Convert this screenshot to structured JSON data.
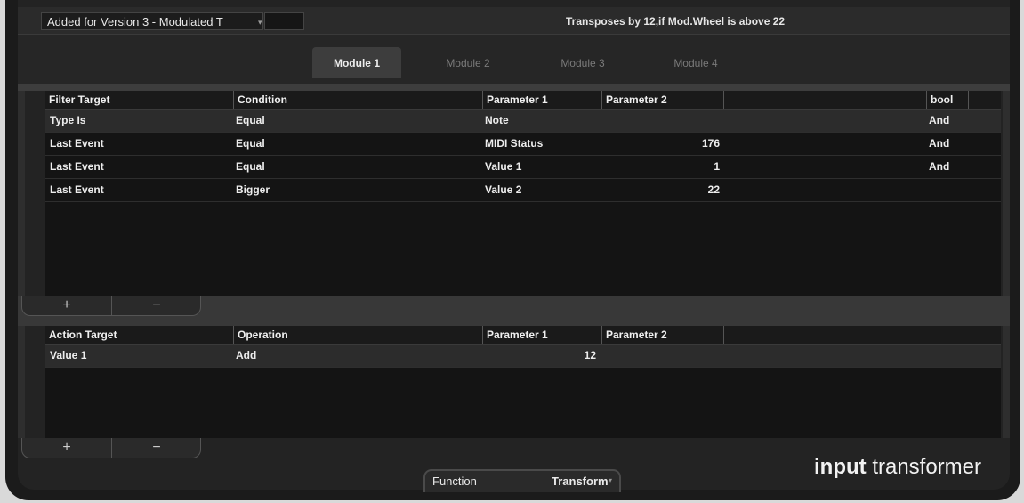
{
  "preset": {
    "name": "Added for Version 3 - Modulated T",
    "arrow": "▾"
  },
  "description": "Transposes by 12,if Mod.Wheel is above 22",
  "tabs": [
    {
      "label": "Module 1",
      "active": true
    },
    {
      "label": "Module 2",
      "active": false
    },
    {
      "label": "Module 3",
      "active": false
    },
    {
      "label": "Module 4",
      "active": false
    }
  ],
  "filter_table": {
    "headers": [
      "Filter Target",
      "Condition",
      "Parameter 1",
      "Parameter 2",
      "bool"
    ],
    "rows": [
      {
        "target": "Type Is",
        "condition": "Equal",
        "param1": "Note",
        "param2": "",
        "bool": "And"
      },
      {
        "target": "Last Event",
        "condition": "Equal",
        "param1": "MIDI Status",
        "param2": "176",
        "bool": "And"
      },
      {
        "target": "Last Event",
        "condition": "Equal",
        "param1": "Value 1",
        "param2": "1",
        "bool": "And"
      },
      {
        "target": "Last Event",
        "condition": "Bigger",
        "param1": "Value 2",
        "param2": "22",
        "bool": ""
      }
    ]
  },
  "action_table": {
    "headers": [
      "Action Target",
      "Operation",
      "Parameter 1",
      "Parameter 2"
    ],
    "rows": [
      {
        "target": "Value 1",
        "operation": "Add",
        "param1": "12",
        "param2": ""
      }
    ]
  },
  "buttons": {
    "add": "+",
    "remove": "−"
  },
  "function": {
    "label": "Function",
    "value": "Transform",
    "arrow": "▾"
  },
  "brand": {
    "bold": "input",
    "light": "transformer"
  },
  "colors": {
    "background": "#232323",
    "text": "#ededed",
    "tab_inactive": "#7a7a7a"
  }
}
